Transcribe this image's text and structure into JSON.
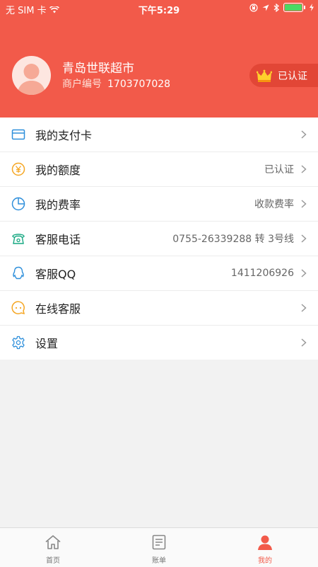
{
  "status_bar": {
    "carrier": "无 SIM 卡",
    "time": "下午5:29"
  },
  "profile": {
    "merchant_name": "青岛世联超市",
    "merchant_id_label": "商户编号",
    "merchant_id": "1703707028",
    "verified_label": "已认证",
    "avatar_icon": "user-avatar-icon",
    "crown_icon": "crown-icon"
  },
  "menu": {
    "items": [
      {
        "label": "我的支付卡",
        "value": "",
        "icon": "card-icon"
      },
      {
        "label": "我的额度",
        "value": "已认证",
        "icon": "yen-icon"
      },
      {
        "label": "我的费率",
        "value": "收款费率",
        "icon": "clock-pie-icon"
      },
      {
        "label": "客服电话",
        "value": "0755-26339288 转 3号线",
        "icon": "phone-icon"
      },
      {
        "label": "客服QQ",
        "value": "1411206926",
        "icon": "qq-icon"
      },
      {
        "label": "在线客服",
        "value": "",
        "icon": "chat-icon"
      },
      {
        "label": "设置",
        "value": "",
        "icon": "gear-icon"
      }
    ]
  },
  "tabbar": {
    "tabs": [
      {
        "label": "首页",
        "icon": "home-icon"
      },
      {
        "label": "账单",
        "icon": "bill-icon"
      },
      {
        "label": "我的",
        "icon": "profile-icon"
      }
    ]
  },
  "colors": {
    "accent": "#f25a4a",
    "icon_blue": "#2e8fdb",
    "icon_orange": "#f5a623",
    "icon_green": "#17a882"
  }
}
